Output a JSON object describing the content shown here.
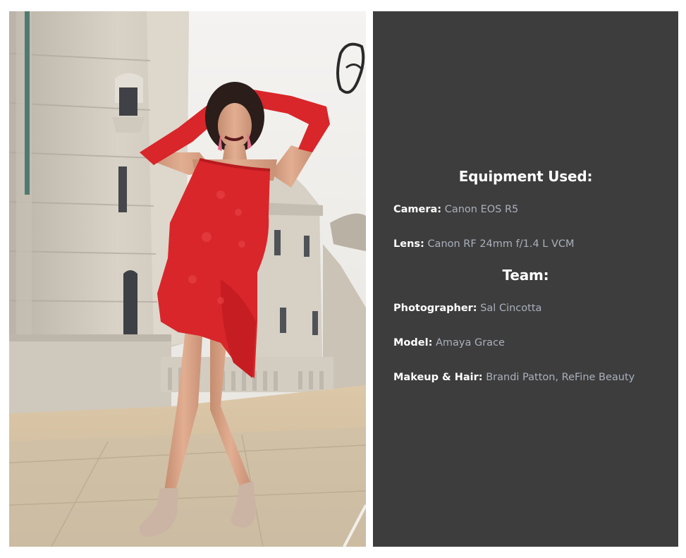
{
  "equipment": {
    "heading": "Equipment Used:",
    "items": [
      {
        "label": "Camera:",
        "value": "Canon EOS R5"
      },
      {
        "label": "Lens:",
        "value": "Canon RF 24mm f/1.4 L VCM"
      }
    ]
  },
  "team": {
    "heading": "Team:",
    "items": [
      {
        "label": "Photographer:",
        "value": "Sal Cincotta"
      },
      {
        "label": "Model:",
        "value": "Amaya Grace"
      },
      {
        "label": "Makeup & Hair:",
        "value": "Brandi Patton, ReFine Beauty"
      }
    ]
  },
  "colors": {
    "panel_background": "#3d3d3d",
    "label_text": "#ffffff",
    "value_text": "#a9b0bb",
    "dress": "#d8262a"
  }
}
